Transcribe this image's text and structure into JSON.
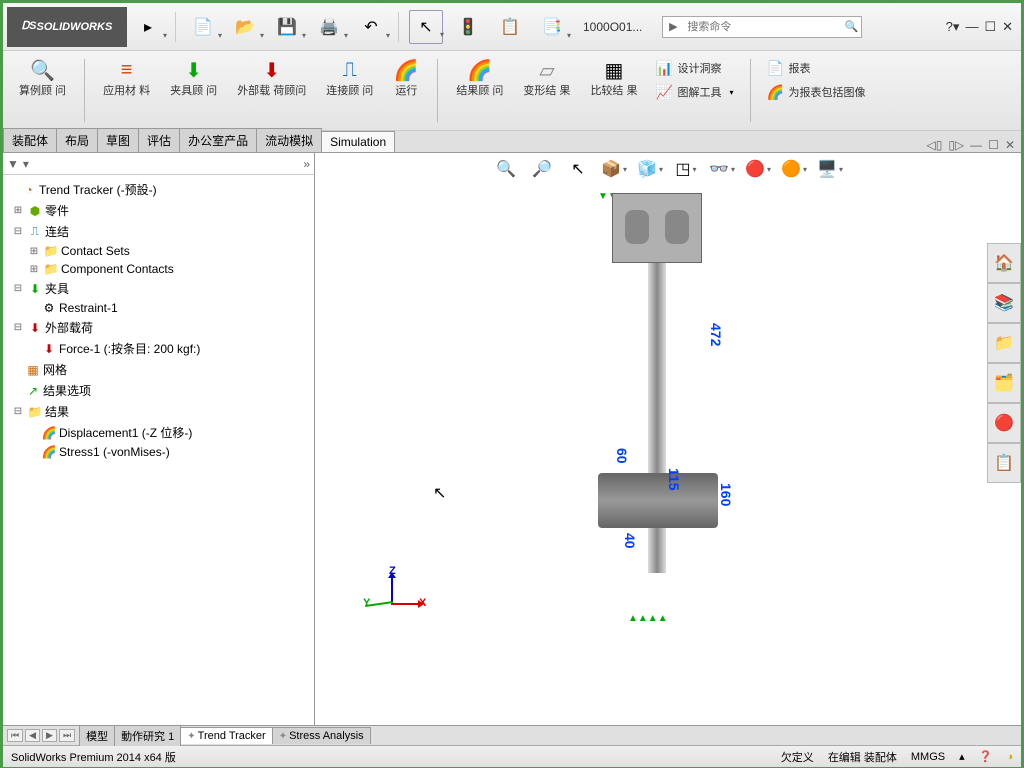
{
  "title": "SOLIDWORKS",
  "doc": "1000O01...",
  "search_placeholder": "搜索命令",
  "ribbon": {
    "study_advisor": "算例顾\n问",
    "apply_material": "应用材\n料",
    "fixture_advisor": "夹具顾\n问",
    "ext_loads": "外部载\n荷顾问",
    "connection": "连接顾\n问",
    "run": "运行",
    "results_advisor": "结果顾\n问",
    "deform": "变形结\n果",
    "compare": "比较结\n果",
    "design_insight": "设计洞察",
    "plot_tools": "图解工具",
    "report": "报表",
    "include_image": "为报表包括图像"
  },
  "tabs": [
    "装配体",
    "布局",
    "草图",
    "评估",
    "办公室产品",
    "流动模拟",
    "Simulation"
  ],
  "tree": {
    "root": "Trend Tracker (-预設-)",
    "parts": "零件",
    "connections": "连结",
    "contact_sets": "Contact Sets",
    "comp_contacts": "Component Contacts",
    "fixtures": "夹具",
    "restraint": "Restraint-1",
    "loads": "外部载荷",
    "force": "Force-1 (:按条目: 200 kgf:)",
    "mesh": "网格",
    "result_opts": "结果选项",
    "results": "结果",
    "disp": "Displacement1 (-Z 位移-)",
    "stress": "Stress1 (-vonMises-)"
  },
  "dims": {
    "d472": "472",
    "d60": "60",
    "d115": "115",
    "d40": "40",
    "d160": "160"
  },
  "axes": {
    "x": "X",
    "y": "Y",
    "z": "Z"
  },
  "btabs": {
    "model": "模型",
    "motion": "動作研究 1",
    "trend": "Trend Tracker",
    "stress": "Stress Analysis"
  },
  "status": {
    "app": "SolidWorks Premium 2014 x64 版",
    "undef": "欠定义",
    "editing": "在编辑 装配体",
    "units": "MMGS"
  }
}
